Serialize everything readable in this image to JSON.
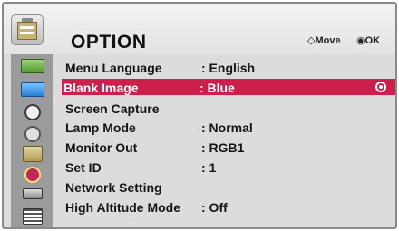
{
  "header": {
    "title": "OPTION",
    "hints": {
      "move": "◇Move",
      "ok": "◉OK"
    },
    "icon": "clipboard-option-icon"
  },
  "menu": {
    "items": [
      {
        "label": "Menu Language",
        "value": ": English"
      },
      {
        "label": "Blank Image",
        "value": ": Blue",
        "selected": true
      },
      {
        "label": "Screen Capture",
        "value": ""
      },
      {
        "label": "Lamp Mode",
        "value": ": Normal"
      },
      {
        "label": "Monitor Out",
        "value": ": RGB1"
      },
      {
        "label": "Set ID",
        "value": ": 1"
      },
      {
        "label": "Network Setting",
        "value": ""
      },
      {
        "label": "High Altitude Mode",
        "value": ": Off"
      }
    ]
  },
  "sidebar": {
    "icons": [
      "picture-icon",
      "audio-icon",
      "time-icon",
      "clock-icon",
      "option-icon",
      "info-icon",
      "input-icon",
      "3d-icon"
    ],
    "active_index": 4
  },
  "colors": {
    "selection": "#cc1f4b",
    "panel": "#e6e6e6",
    "sidebar": "#9b9b9b"
  }
}
